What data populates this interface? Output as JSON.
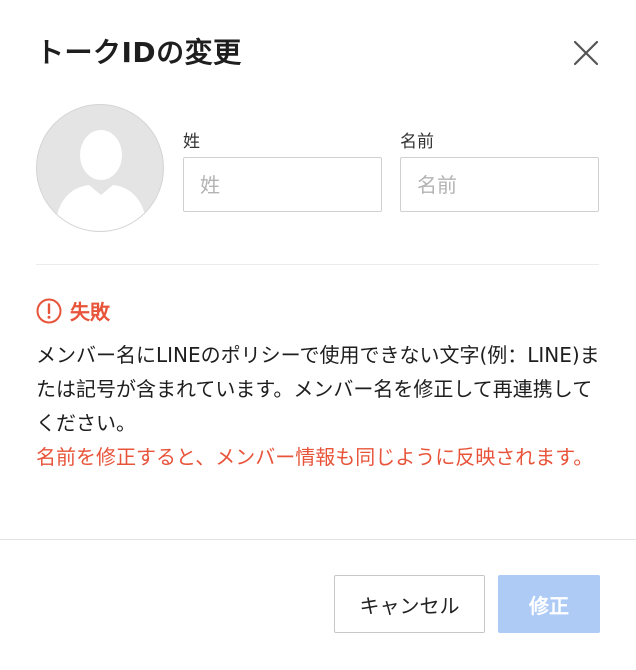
{
  "dialog": {
    "title": "トークIDの変更",
    "close_icon": "close-icon"
  },
  "form": {
    "avatar_icon": "default-user-avatar-icon",
    "last_name": {
      "label": "姓",
      "placeholder": "姓",
      "value": ""
    },
    "first_name": {
      "label": "名前",
      "placeholder": "名前",
      "value": ""
    }
  },
  "error": {
    "icon": "exclamation-circle-icon",
    "title": "失敗",
    "message": "メンバー名にLINEのポリシーで使用できない文字(例：LINE)または記号が含まれています。メンバー名を修正して再連携してください。",
    "warning": "名前を修正すると、メンバー情報も同じように反映されます。",
    "color": "#e8543a"
  },
  "footer": {
    "cancel_label": "キャンセル",
    "submit_label": "修正",
    "submit_color": "#aecbf6"
  }
}
